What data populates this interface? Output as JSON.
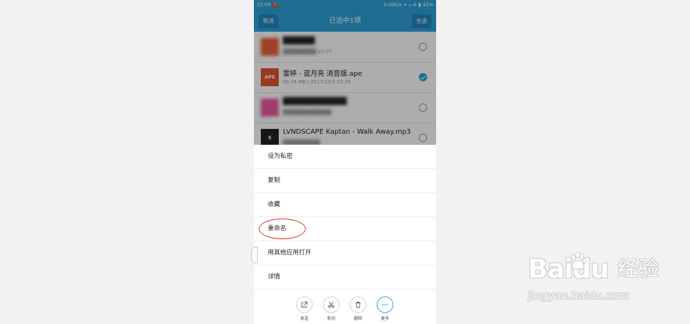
{
  "statusbar": {
    "time": "22:09",
    "notif_badge": "5",
    "speed": "0.00K/s",
    "battery": "42%"
  },
  "header": {
    "cancel_label": "取消",
    "title": "已选中1项",
    "select_all_label": "全选"
  },
  "files": [
    {
      "thumb_color": "#e8623a",
      "thumb_label": "",
      "name": "",
      "meta": "20:07",
      "checked": false,
      "blurred": true
    },
    {
      "thumb_color": "#e2542d",
      "thumb_label": "APE",
      "name": "雷婷 - 蓝月亮 消音版.ape",
      "meta": "90.34 MB  |  2017/10/3 02:28",
      "checked": true,
      "blurred": false
    },
    {
      "thumb_color": "#e65aa2",
      "thumb_label": "",
      "name": "",
      "meta": "",
      "checked": false,
      "blurred": true
    },
    {
      "thumb_color": "#222222",
      "thumb_label": "S",
      "name": "LVNDSCAPE Kaptan - Walk Away.mp3",
      "meta": "",
      "checked": false,
      "blurred": false
    }
  ],
  "menu": [
    {
      "label": "设为私密"
    },
    {
      "label": "复制"
    },
    {
      "label": "收藏"
    },
    {
      "label": "重命名"
    },
    {
      "label": "用其他应用打开"
    },
    {
      "label": "详情"
    }
  ],
  "actions": [
    {
      "label": "发送",
      "icon": "share-icon"
    },
    {
      "label": "剪切",
      "icon": "scissors-icon"
    },
    {
      "label": "删除",
      "icon": "trash-icon"
    },
    {
      "label": "更多",
      "icon": "more-icon"
    }
  ],
  "watermark": {
    "brand": "Baidu",
    "cn": "经验",
    "url": "jingyan.baidu.com"
  },
  "colors": {
    "accent": "#2f9fd8",
    "highlight_oval": "#d9302b"
  }
}
